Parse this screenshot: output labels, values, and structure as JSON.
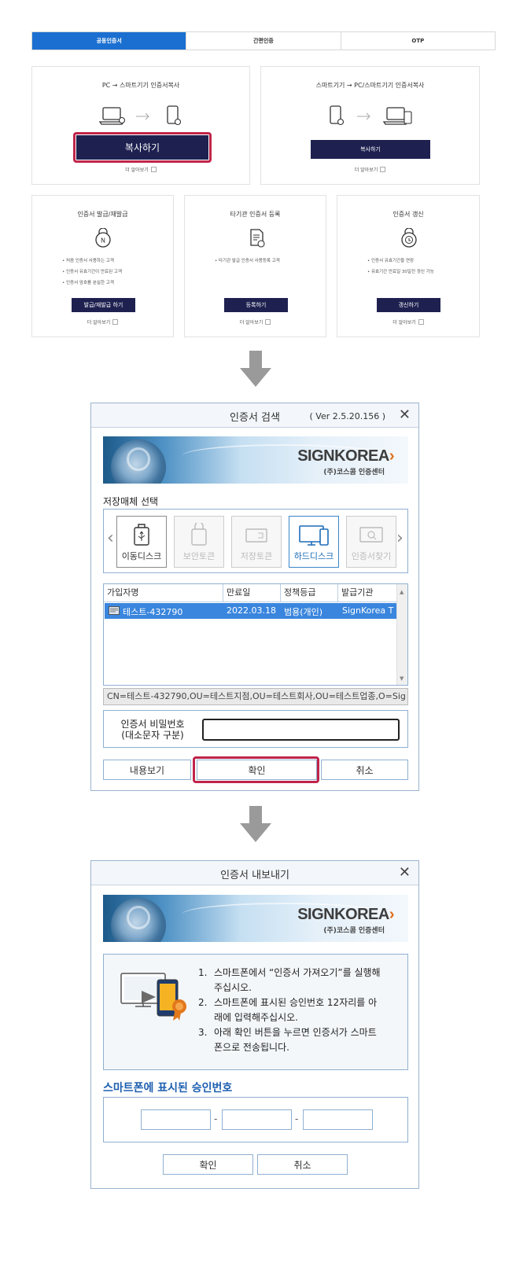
{
  "tabs": [
    "공동인증서",
    "간편인증",
    "OTP"
  ],
  "copy_cards": [
    {
      "title": "PC → 스마트기기 인증서복사",
      "button": "복사하기",
      "more": "더 알아보기"
    },
    {
      "title": "스마트기기 → PC/스마트기기 인증서복사",
      "button": "복사하기",
      "more": "더 알아보기"
    }
  ],
  "service_cards": [
    {
      "title": "인증서 발급/재발급",
      "bullets": [
        "처음 인증서 사용하는 고객",
        "인증서 유효기간이 만료된 고객",
        "인증서 암호를 분실한 고객"
      ],
      "button": "발급/재발급 하기",
      "more": "더 알아보기"
    },
    {
      "title": "타기관 인증서 등록",
      "bullets": [
        "타기관 발급 인증서 사용등록 고객"
      ],
      "button": "등록하기",
      "more": "더 알아보기"
    },
    {
      "title": "인증서 갱신",
      "bullets": [
        "인증서 유효기간을 연장",
        "유효기간 만료일 30일전 갱신 가능"
      ],
      "button": "갱신하기",
      "more": "더 알아보기"
    }
  ],
  "brand": {
    "name": "SIGNKOREA",
    "arrow": "›",
    "sub": "(주)코스콤 인증센터"
  },
  "search_dialog": {
    "title": "인증서 검색",
    "version": "( Ver 2.5.20.156 )",
    "close": "✕",
    "media_label": "저장매체 선택",
    "media": [
      "이동디스크",
      "보안토큰",
      "저장토큰",
      "하드디스크",
      "인증서찾기"
    ],
    "columns": [
      "가입자명",
      "만료일",
      "정책등급",
      "발급기관"
    ],
    "row": {
      "name": "테스트-432790",
      "expiry": "2022.03.18",
      "grade": "범용(개인)",
      "issuer": "SignKorea T"
    },
    "dn": "CN=테스트-432790,OU=테스트지점,OU=테스트회사,OU=테스트업종,O=Sig",
    "password_label_1": "인증서 비밀번호",
    "password_label_2": "(대소문자 구분)",
    "buttons": {
      "view": "내용보기",
      "ok": "확인",
      "cancel": "취소"
    }
  },
  "export_dialog": {
    "title": "인증서 내보내기",
    "close": "✕",
    "instructions": [
      {
        "num": "1.",
        "line1": "스마트폰에서 “인증서 가져오기”를 실행해",
        "line2": "주십시오."
      },
      {
        "num": "2.",
        "line1": "스마트폰에 표시된 승인번호 12자리를 아",
        "line2": "래에 입력해주십시오."
      },
      {
        "num": "3.",
        "line1": "아래 확인 버튼을 누르면 인증서가 스마트",
        "line2": "폰으로 전송됩니다."
      }
    ],
    "approval_title": "스마트폰에 표시된 승인번호",
    "dash": "-",
    "buttons": {
      "ok": "확인",
      "cancel": "취소"
    }
  },
  "colors": {
    "tab_active": "#1b6fd1",
    "navy": "#1e2150",
    "highlight": "#c0244a",
    "selected_row": "#3a86de"
  }
}
